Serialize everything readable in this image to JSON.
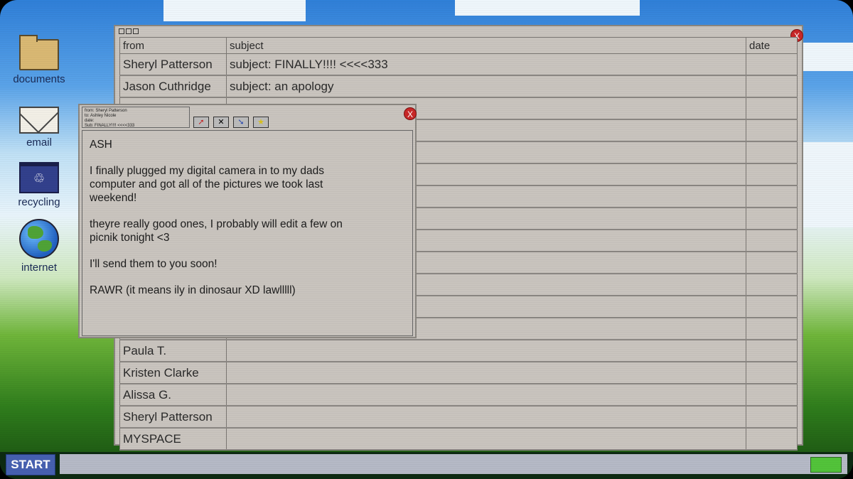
{
  "desktop": {
    "icons": [
      {
        "label": "documents"
      },
      {
        "label": "email"
      },
      {
        "label": "recycling"
      },
      {
        "label": "internet"
      }
    ]
  },
  "inbox": {
    "close_label": "X",
    "columns": {
      "from": "from",
      "subject": "subject",
      "date": "date"
    },
    "rows": [
      {
        "from": "Sheryl Patterson",
        "subject": "subject: FINALLY!!!! <<<<333",
        "date": ""
      },
      {
        "from": "Jason Cuthridge",
        "subject": "subject: an apology",
        "date": ""
      },
      {
        "from": "",
        "subject": "",
        "date": ""
      },
      {
        "from": "",
        "subject": "",
        "date": ""
      },
      {
        "from": "",
        "subject": "",
        "date": ""
      },
      {
        "from": "",
        "subject": "",
        "date": ""
      },
      {
        "from": "",
        "subject": "",
        "date": ""
      },
      {
        "from": "",
        "subject": "",
        "date": ""
      },
      {
        "from": "",
        "subject": "",
        "date": ""
      },
      {
        "from": "",
        "subject": "",
        "date": ""
      },
      {
        "from": "",
        "subject": "",
        "date": ""
      },
      {
        "from": "",
        "subject": "",
        "date": ""
      },
      {
        "from": "",
        "subject": "",
        "date": ""
      },
      {
        "from": "Paula T.",
        "subject": "",
        "date": ""
      },
      {
        "from": "Kristen Clarke",
        "subject": "",
        "date": ""
      },
      {
        "from": "Alissa G.",
        "subject": "",
        "date": ""
      },
      {
        "from": "Sheryl Patterson",
        "subject": "",
        "date": ""
      },
      {
        "from": "MYSPACE",
        "subject": "",
        "date": ""
      }
    ]
  },
  "message": {
    "header_from": "from: Sheryl Patterson",
    "header_to": "to: Ashley Nicole",
    "header_date": "date:",
    "header_sub": "Sub: FINALLY!!!! <<<<333",
    "close_label": "X",
    "tool_icons": [
      "reply-icon",
      "delete-icon",
      "forward-icon",
      "star-icon"
    ],
    "paragraphs": [
      "ASH",
      "I finally plugged my digital camera in to my dads\ncomputer and got all of the pictures we took last\nweekend!",
      "theyre really good ones, I probably will edit a few on\npicnik tonight <3",
      "I'll send them to you soon!",
      "RAWR (it means ily in dinosaur XD lawlllll)"
    ]
  },
  "taskbar": {
    "start_label": "START"
  },
  "colors": {
    "window_bg": "#c9c4be",
    "close_red": "#c82828",
    "start_blue": "#4660b0",
    "tray_green": "#52c33a"
  }
}
